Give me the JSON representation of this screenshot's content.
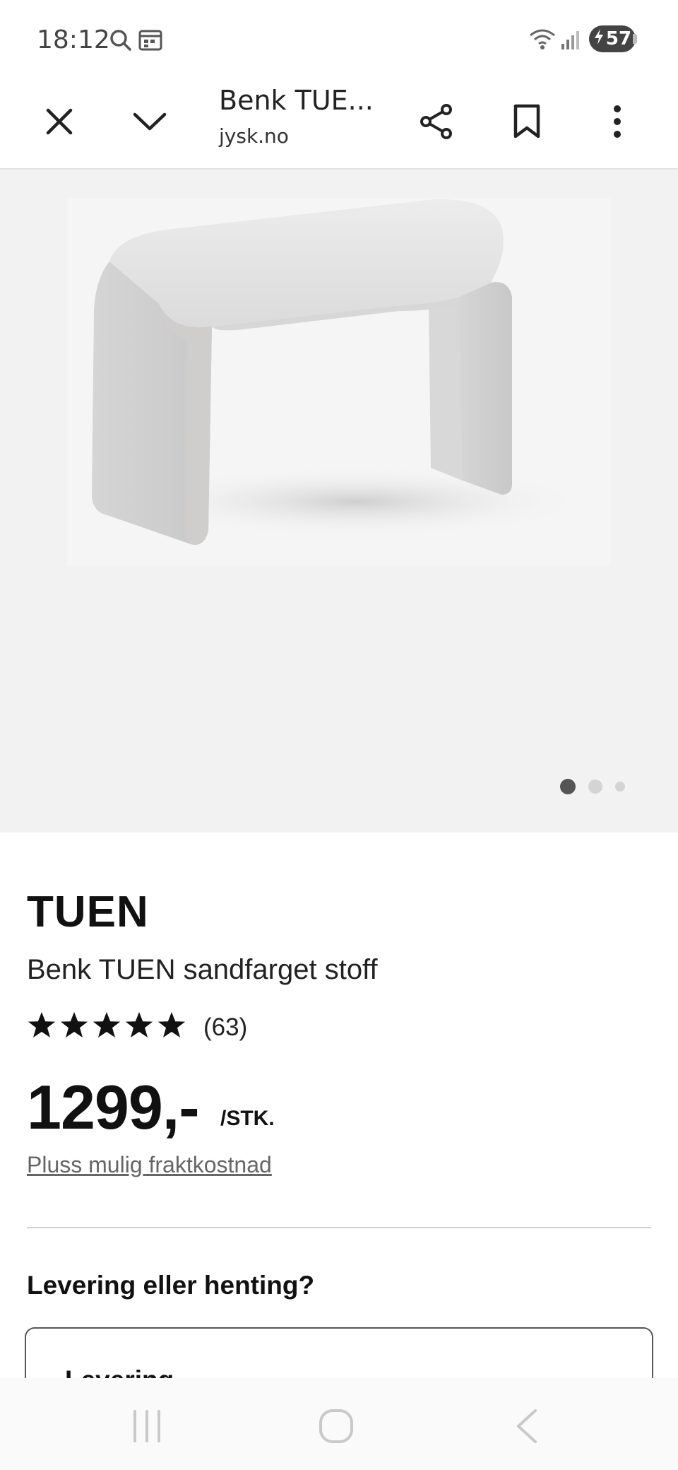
{
  "status_bar": {
    "time": "18:12",
    "battery": "57",
    "icons": [
      "search-icon",
      "calendar-icon",
      "wifi-icon",
      "signal-icon",
      "charging-icon"
    ]
  },
  "browser": {
    "title": "Benk TUE...",
    "url": "jysk.no",
    "icons": [
      "close-icon",
      "chevron-down-icon",
      "share-icon",
      "bookmark-icon",
      "more-vertical-icon"
    ]
  },
  "gallery": {
    "image_alt": "bench-photo",
    "current_index": 1,
    "total": 3
  },
  "product": {
    "brand": "TUEN",
    "name": "Benk TUEN sandfarget stoff",
    "rating_stars": 5,
    "rating_count": "(63)",
    "price": "1299,-",
    "unit": "/STK.",
    "freight_link": "Pluss mulig fraktkostnad"
  },
  "delivery": {
    "heading": "Levering eller henting?",
    "option_title": "Levering"
  },
  "nav": {
    "icons": [
      "recent-apps-icon",
      "home-icon",
      "back-icon"
    ]
  },
  "colors": {
    "text": "#111111",
    "muted": "#666666",
    "gallery_bg": "#f2f2f2",
    "dot_active": "#555555",
    "dot_inactive": "#d4d4d4"
  }
}
